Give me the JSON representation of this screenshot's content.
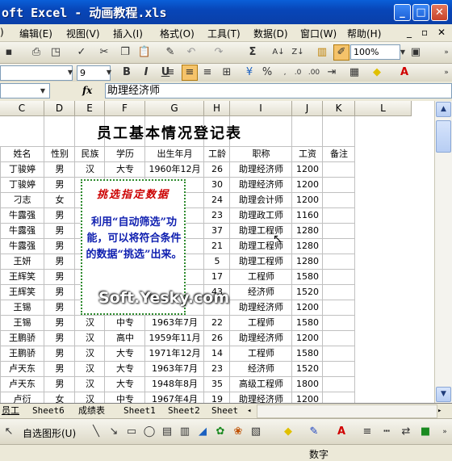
{
  "window": {
    "title": "oft Excel - 动画教程.xls"
  },
  "menu": [
    "编辑(E)",
    "视图(V)",
    "插入(I)",
    "格式(O)",
    "工具(T)",
    "数据(D)",
    "窗口(W)",
    "帮助(H)"
  ],
  "toolbar": {
    "zoom": "100%",
    "font_size": "9",
    "bold": "B",
    "italic": "I",
    "underline": "U",
    "sigma": "Σ",
    "percent": "%"
  },
  "formula_bar": {
    "fx": "fx",
    "content": "助理经济师"
  },
  "columns": [
    "C",
    "D",
    "E",
    "F",
    "G",
    "H",
    "I",
    "J",
    "K",
    "L"
  ],
  "sheet": {
    "title": "员工基本情况登记表",
    "headers": [
      "姓名",
      "性别",
      "民族",
      "学历",
      "出生年月",
      "工龄",
      "职称",
      "工资",
      "备注"
    ],
    "rows": [
      [
        "丁骏婷",
        "男",
        "汉",
        "大专",
        "1960年12月",
        "26",
        "助理经济师",
        "1200",
        ""
      ],
      [
        "丁骏婷",
        "男",
        "",
        "",
        "2月",
        "30",
        "助理经济师",
        "1200",
        ""
      ],
      [
        "刁志",
        "女",
        "",
        "",
        "2月",
        "24",
        "助理会计师",
        "1200",
        ""
      ],
      [
        "牛露强",
        "男",
        "",
        "",
        "2月",
        "23",
        "助理政工师",
        "1160",
        ""
      ],
      [
        "牛露强",
        "男",
        "",
        "",
        "2月",
        "37",
        "助理工程师",
        "1280",
        ""
      ],
      [
        "牛露强",
        "男",
        "",
        "",
        "2月",
        "21",
        "助理工程师",
        "1280",
        ""
      ],
      [
        "王妍",
        "男",
        "",
        "",
        "2月",
        "5",
        "助理工程师",
        "1280",
        ""
      ],
      [
        "王辉笑",
        "男",
        "",
        "",
        "1月",
        "17",
        "工程师",
        "1580",
        ""
      ],
      [
        "王辉笑",
        "男",
        "",
        "",
        "1月",
        "43",
        "经济师",
        "1520",
        ""
      ],
      [
        "王锡",
        "男",
        "",
        "",
        "",
        "",
        "助理经济师",
        "1200",
        ""
      ],
      [
        "王锡",
        "男",
        "汉",
        "中专",
        "1963年7月",
        "22",
        "工程师",
        "1580",
        ""
      ],
      [
        "王鹏骄",
        "男",
        "汉",
        "高中",
        "1959年11月",
        "26",
        "助理经济师",
        "1200",
        ""
      ],
      [
        "王鹏骄",
        "男",
        "汉",
        "大专",
        "1971年12月",
        "14",
        "工程师",
        "1580",
        ""
      ],
      [
        "卢天东",
        "男",
        "汉",
        "大专",
        "1963年7月",
        "23",
        "经济师",
        "1520",
        ""
      ],
      [
        "卢天东",
        "男",
        "汉",
        "大专",
        "1948年8月",
        "35",
        "高级工程师",
        "1800",
        ""
      ],
      [
        "卢衍",
        "女",
        "汉",
        "中专",
        "1967年4月",
        "19",
        "助理经济师",
        "1200",
        ""
      ]
    ]
  },
  "callout": {
    "heading": "挑选指定数据",
    "body": "利用“自动筛选”功能，可以将符合条件的数据“挑选”出来。"
  },
  "watermark": "Soft.Yesky.com",
  "tabs": [
    "员工",
    "Sheet6",
    "成绩表",
    "Sheet1",
    "Sheet2",
    "Sheet"
  ],
  "drawbar": {
    "autoshapes": "自选图形(U)"
  },
  "status": {
    "mode": "数字"
  }
}
